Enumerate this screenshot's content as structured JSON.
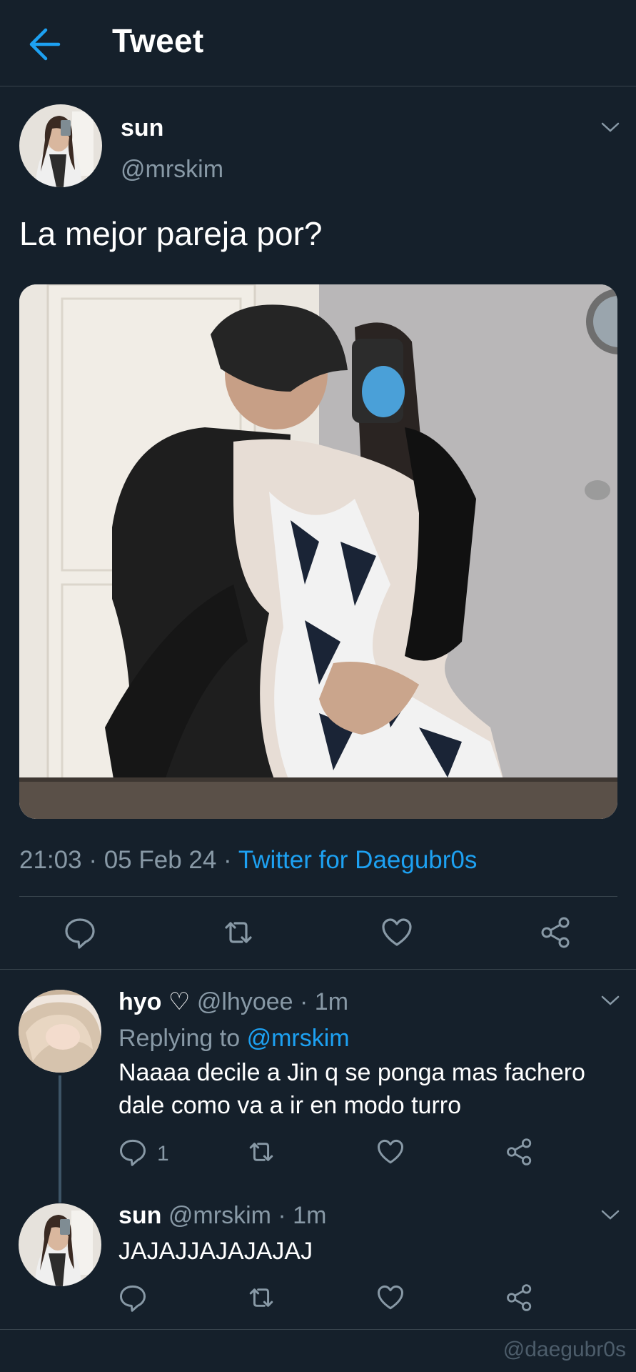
{
  "header": {
    "title": "Tweet",
    "back_icon": "arrow-left-icon",
    "accent": "#1da1f2"
  },
  "tweet": {
    "name": "sun",
    "handle": "@mrskim",
    "text": "La mejor pareja por?",
    "photo_alt": "mirror selfie photo",
    "time": "21:03",
    "date": "05 Feb 24",
    "source": "Twitter for Daegubr0s"
  },
  "actions": [
    "reply-icon",
    "retweet-icon",
    "like-icon",
    "share-icon"
  ],
  "replies": [
    {
      "name": "hyo",
      "name_suffix": "♡",
      "handle": "@lhyoee",
      "time": "1m",
      "replying_label": "Replying to",
      "replying_to": "@mrskim",
      "text_line1": "Naaaa decile a Jin q se ponga mas fachero",
      "text_line2": "dale como va a ir en modo turro",
      "reply_count": "1"
    },
    {
      "name": "sun",
      "handle": "@mrskim",
      "time": "1m",
      "text": "JAJAJJAJAJAJAJ"
    }
  ],
  "watermark": "@daegubr0s",
  "colors": {
    "background": "#15202b",
    "border": "#38444d",
    "secondary_text": "#8899a6",
    "link": "#1da1f2"
  }
}
